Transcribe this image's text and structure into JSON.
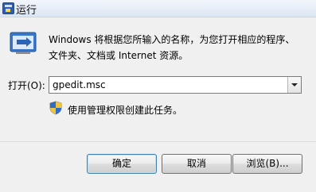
{
  "window": {
    "title": "运行"
  },
  "description": "Windows 将根据您所输入的名称，为您打开相应的程序、文件夹、文档或 Internet 资源。",
  "open_field": {
    "label": "打开(O):",
    "value": "gpedit.msc"
  },
  "admin_notice": "使用管理权限创建此任务。",
  "buttons": {
    "ok": "确定",
    "cancel": "取消",
    "browse": "浏览(B)..."
  }
}
